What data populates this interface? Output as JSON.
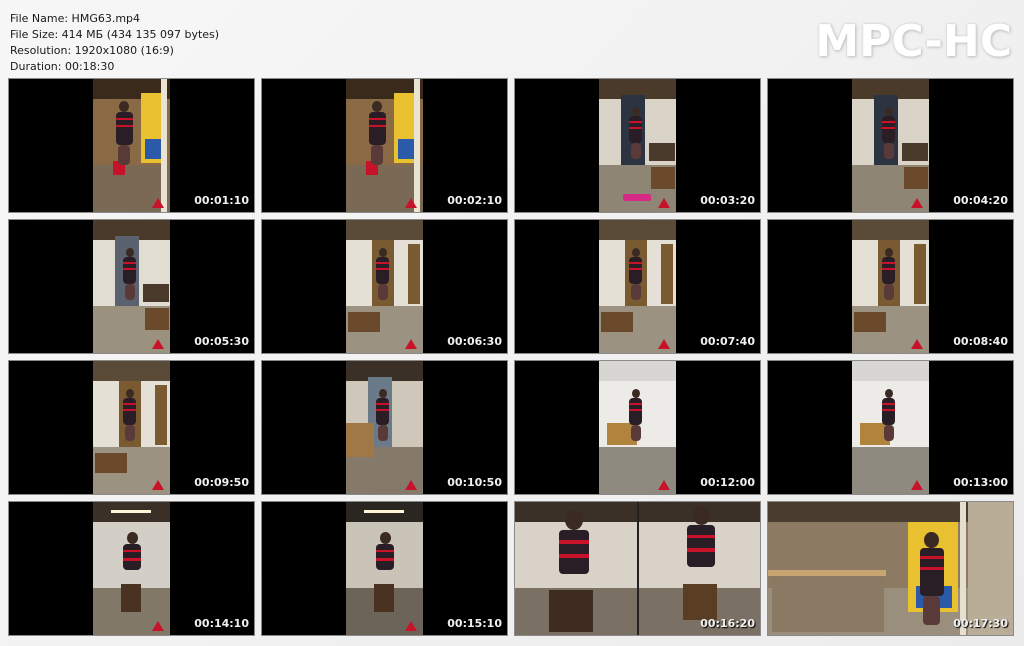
{
  "header": {
    "file_name": "File Name: HMG63.mp4",
    "file_size": "File Size: 414 МБ (434 135 097 bytes)",
    "resolution": "Resolution: 1920x1080 (16:9)",
    "duration": "Duration: 00:18:30"
  },
  "logo": "MPC-HC",
  "colors": {
    "rope": "#c8122a",
    "letterbox": "#000000",
    "timestamp": "#f0f0f0"
  },
  "thumbnails": [
    {
      "time": "00:01:10",
      "scene": "bar-mural"
    },
    {
      "time": "00:02:10",
      "scene": "bar-mural"
    },
    {
      "time": "00:03:20",
      "scene": "doorway"
    },
    {
      "time": "00:04:20",
      "scene": "doorway"
    },
    {
      "time": "00:05:30",
      "scene": "doorway-far"
    },
    {
      "time": "00:06:30",
      "scene": "shelves"
    },
    {
      "time": "00:07:40",
      "scene": "shelves"
    },
    {
      "time": "00:08:40",
      "scene": "shelves"
    },
    {
      "time": "00:09:50",
      "scene": "shelves"
    },
    {
      "time": "00:10:50",
      "scene": "stairs"
    },
    {
      "time": "00:12:00",
      "scene": "white-room"
    },
    {
      "time": "00:13:00",
      "scene": "white-room"
    },
    {
      "time": "00:14:10",
      "scene": "stool"
    },
    {
      "time": "00:15:10",
      "scene": "stool-lit"
    },
    {
      "time": "00:16:20",
      "scene": "split-wide"
    },
    {
      "time": "00:17:30",
      "scene": "bar-wide"
    }
  ]
}
